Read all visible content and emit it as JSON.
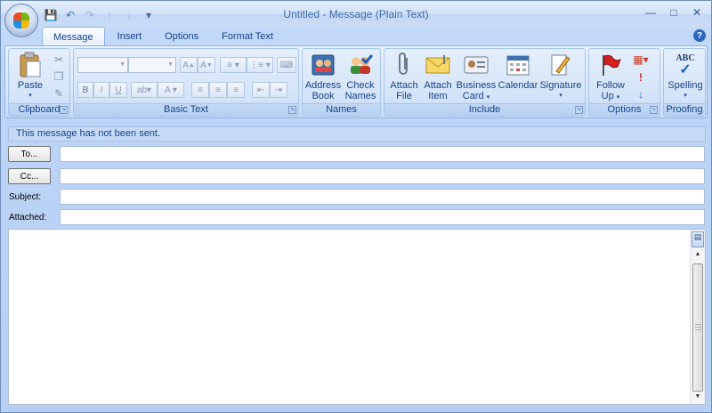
{
  "window": {
    "title_part1": "Untitled",
    "title_sep": " - ",
    "title_part2": "Message (Plain Text)"
  },
  "tabs": [
    {
      "label": "Message",
      "active": true
    },
    {
      "label": "Insert",
      "active": false
    },
    {
      "label": "Options",
      "active": false
    },
    {
      "label": "Format Text",
      "active": false
    }
  ],
  "ribbon": {
    "clipboard": {
      "label": "Clipboard",
      "paste": "Paste"
    },
    "basic_text": {
      "label": "Basic Text"
    },
    "names": {
      "label": "Names",
      "address_book_1": "Address",
      "address_book_2": "Book",
      "check_names_1": "Check",
      "check_names_2": "Names"
    },
    "include": {
      "label": "Include",
      "attach_file_1": "Attach",
      "attach_file_2": "File",
      "attach_item_1": "Attach",
      "attach_item_2": "Item",
      "business_card_1": "Business",
      "business_card_2": "Card",
      "calendar": "Calendar",
      "signature": "Signature"
    },
    "options": {
      "label": "Options",
      "follow_up_1": "Follow",
      "follow_up_2": "Up"
    },
    "proofing": {
      "label": "Proofing",
      "spelling": "Spelling",
      "spelling_icon_text": "ABC"
    }
  },
  "infobar": {
    "text": "This message has not been sent."
  },
  "compose": {
    "to_button": "To...",
    "cc_button": "Cc...",
    "subject_label": "Subject:",
    "attached_label": "Attached:",
    "to_value": "",
    "cc_value": "",
    "subject_value": "",
    "attached_value": "",
    "body": ""
  },
  "colors": {
    "accent": "#15428b",
    "ribbon_bg": "#d7e6f9",
    "frame": "#bcd4f6"
  }
}
